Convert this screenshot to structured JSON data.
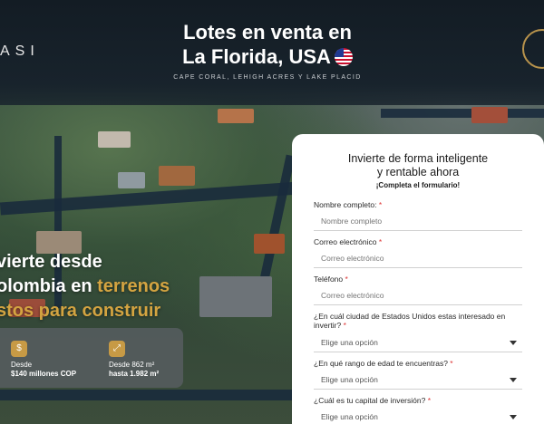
{
  "brand": {
    "name": "ASI"
  },
  "header": {
    "title_line1": "Lotes en venta en",
    "title_line2": "La Florida, USA",
    "flag_icon": "us-flag-icon",
    "subtitle": "CAPE CORAL, LEHIGH ACRES Y LAKE PLACID"
  },
  "hero": {
    "line1": "vierte desde",
    "line2_plain": "olombia en ",
    "line2_gold": "terrenos",
    "line3": "stos para construir",
    "gold_color": "#d4a441",
    "prices": [
      {
        "icon": "dollar-icon",
        "label": "Desde",
        "value": "$140 millones COP"
      },
      {
        "icon": "area-icon",
        "label": "Desde 862 m²",
        "value": "hasta 1.982 m²"
      }
    ]
  },
  "form": {
    "title_line1": "Invierte de forma inteligente",
    "title_line2": "y rentable ahora",
    "subtitle": "¡Completa el formulario!",
    "fields": [
      {
        "label": "Nombre completo:",
        "placeholder": "Nombre completo"
      },
      {
        "label": "Correo electrónico",
        "placeholder": "Correo electrónico"
      },
      {
        "label": "Teléfono",
        "placeholder": "Correo electrónico"
      }
    ],
    "selects": [
      {
        "label": "¿En cuál ciudad de Estados Unidos estas interesado en invertir?",
        "value": "Elige una opción"
      },
      {
        "label": "¿En qué rango de edad te encuentras?",
        "value": "Elige una opción"
      },
      {
        "label": "¿Cuál es tu capital de inversión?",
        "value": "Elige una opción"
      }
    ],
    "required_mark": "*"
  }
}
